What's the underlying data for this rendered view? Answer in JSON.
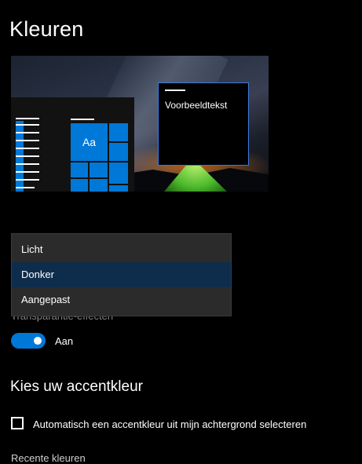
{
  "page": {
    "title": "Kleuren"
  },
  "preview": {
    "sample_text": "Voorbeeldtekst",
    "tile_label": "Aa"
  },
  "mode_dropdown": {
    "options": [
      {
        "label": "Licht",
        "selected": false
      },
      {
        "label": "Donker",
        "selected": true
      },
      {
        "label": "Aangepast",
        "selected": false
      }
    ]
  },
  "transparency": {
    "label": "Transparantie-effecten",
    "toggle_state": "Aan",
    "enabled": true
  },
  "accent": {
    "heading": "Kies uw accentkleur",
    "auto_checkbox_label": "Automatisch een accentkleur uit mijn achtergrond selecteren",
    "auto_checked": false,
    "next_label": "Recente kleuren"
  },
  "colors": {
    "accent": "#0078d7",
    "background": "#000000",
    "dropdown_bg": "#2b2b2b",
    "selected_bg": "#0e2d4c"
  }
}
